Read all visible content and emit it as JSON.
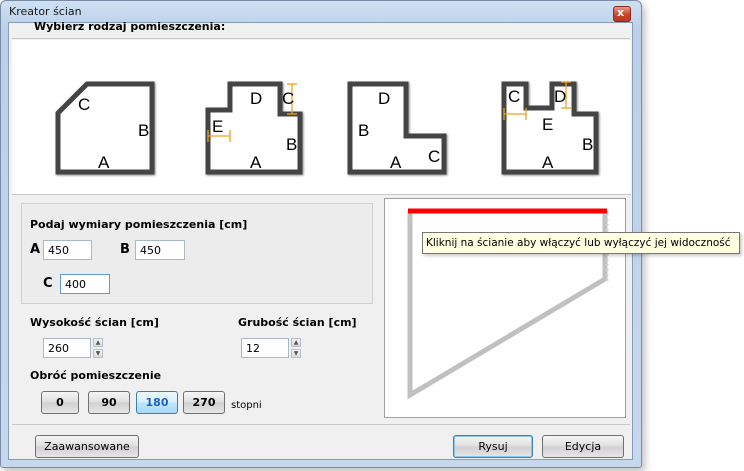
{
  "window": {
    "title": "Kreator ścian",
    "close_glyph": "x"
  },
  "header": {
    "label": "Wybierz rodzaj pomieszczenia:"
  },
  "shapes": [
    {
      "name": "shape-1",
      "labels": [
        "C",
        "B",
        "A"
      ]
    },
    {
      "name": "shape-2",
      "labels": [
        "D",
        "C",
        "E",
        "B",
        "A"
      ]
    },
    {
      "name": "shape-3",
      "labels": [
        "D",
        "B",
        "A",
        "C"
      ]
    },
    {
      "name": "shape-4",
      "labels": [
        "C",
        "D",
        "E",
        "B",
        "A"
      ]
    }
  ],
  "dimensions": {
    "title": "Podaj wymiary pomieszczenia [cm]",
    "a_label": "A",
    "a_value": "450",
    "b_label": "B",
    "b_value": "450",
    "c_label": "C",
    "c_value": "400"
  },
  "wall_height": {
    "label": "Wysokość ścian [cm]",
    "value": "260"
  },
  "wall_thickness": {
    "label": "Grubość ścian [cm]",
    "value": "12"
  },
  "rotate": {
    "label": "Obróć pomieszczenie",
    "options": [
      "0",
      "90",
      "180",
      "270"
    ],
    "selected": "180",
    "unit": "stopni"
  },
  "preview": {
    "highlight_color": "#ff0000",
    "wall_color": "#c0c0c0"
  },
  "tooltip": {
    "text": "Kliknij na ścianie aby włączyć lub wyłączyć jej widoczność"
  },
  "footer": {
    "advanced_label": "Zaawansowane",
    "draw_label": "Rysuj",
    "edit_label": "Edycja"
  },
  "colors": {
    "dimension_marker": "#f0a020",
    "wall_outline": "#333333"
  }
}
